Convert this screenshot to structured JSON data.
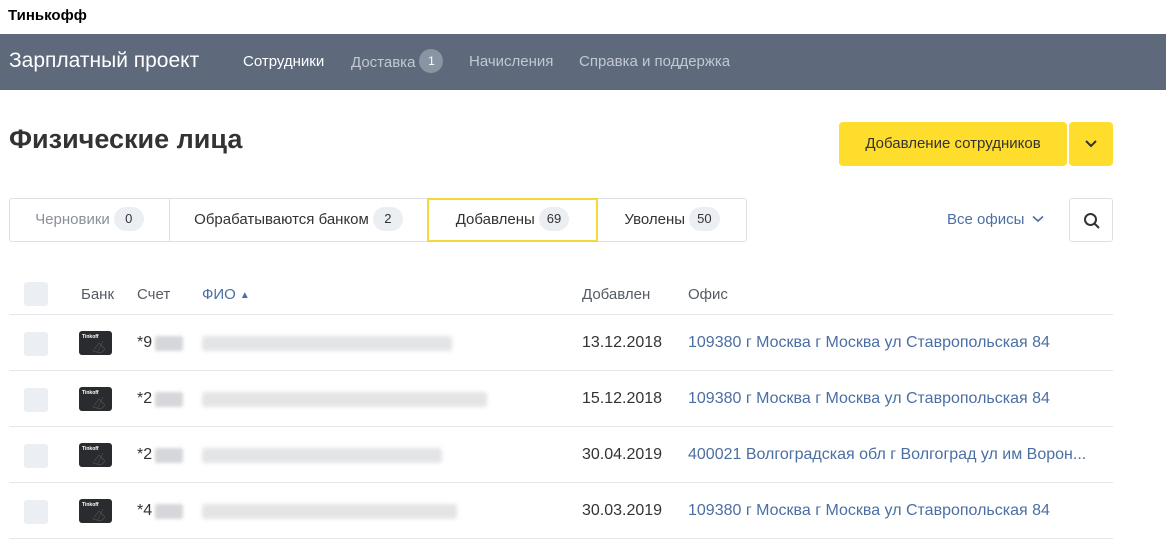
{
  "app": {
    "window_title": "Тинькофф"
  },
  "topnav": {
    "brand": "Зарплатный проект",
    "items": [
      {
        "label": "Сотрудники",
        "active": true
      },
      {
        "label": "Доставка",
        "badge": "1"
      },
      {
        "label": "Начисления"
      },
      {
        "label": "Справка и поддержка"
      }
    ]
  },
  "page": {
    "title": "Физические лица",
    "add_button": "Добавление сотрудников"
  },
  "tabs": [
    {
      "label": "Черновики",
      "count": "0"
    },
    {
      "label": "Обрабатываются банком",
      "count": "2"
    },
    {
      "label": "Добавлены",
      "count": "69",
      "selected": true
    },
    {
      "label": "Уволены",
      "count": "50"
    }
  ],
  "filter": {
    "office": "Все офисы"
  },
  "table": {
    "columns": [
      "Банк",
      "Счет",
      "ФИО",
      "Добавлен",
      "Офис"
    ],
    "sorted_column": "ФИО",
    "rows": [
      {
        "bank": "Tinkoff",
        "account": "*9",
        "date": "13.12.2018",
        "office": "109380 г Москва г Москва ул Ставропольская 84"
      },
      {
        "bank": "Tinkoff",
        "account": "*2",
        "date": "15.12.2018",
        "office": "109380 г Москва г Москва ул Ставропольская 84"
      },
      {
        "bank": "Tinkoff",
        "account": "*2",
        "date": "30.04.2019",
        "office": "400021 Волгоградская обл г Волгоград ул им Ворон..."
      },
      {
        "bank": "Tinkoff",
        "account": "*4",
        "date": "30.03.2019",
        "office": "109380 г Москва г Москва ул Ставропольская 84"
      }
    ]
  },
  "colors": {
    "nav_bg": "#5e6a7c",
    "accent_yellow": "#ffdd2d",
    "link_blue": "#4b6fa3",
    "tab_selected_border": "#f5d93a"
  },
  "icons": [
    "chevron-down-icon",
    "search-icon",
    "sort-asc-icon",
    "tinkoff-card-icon"
  ]
}
